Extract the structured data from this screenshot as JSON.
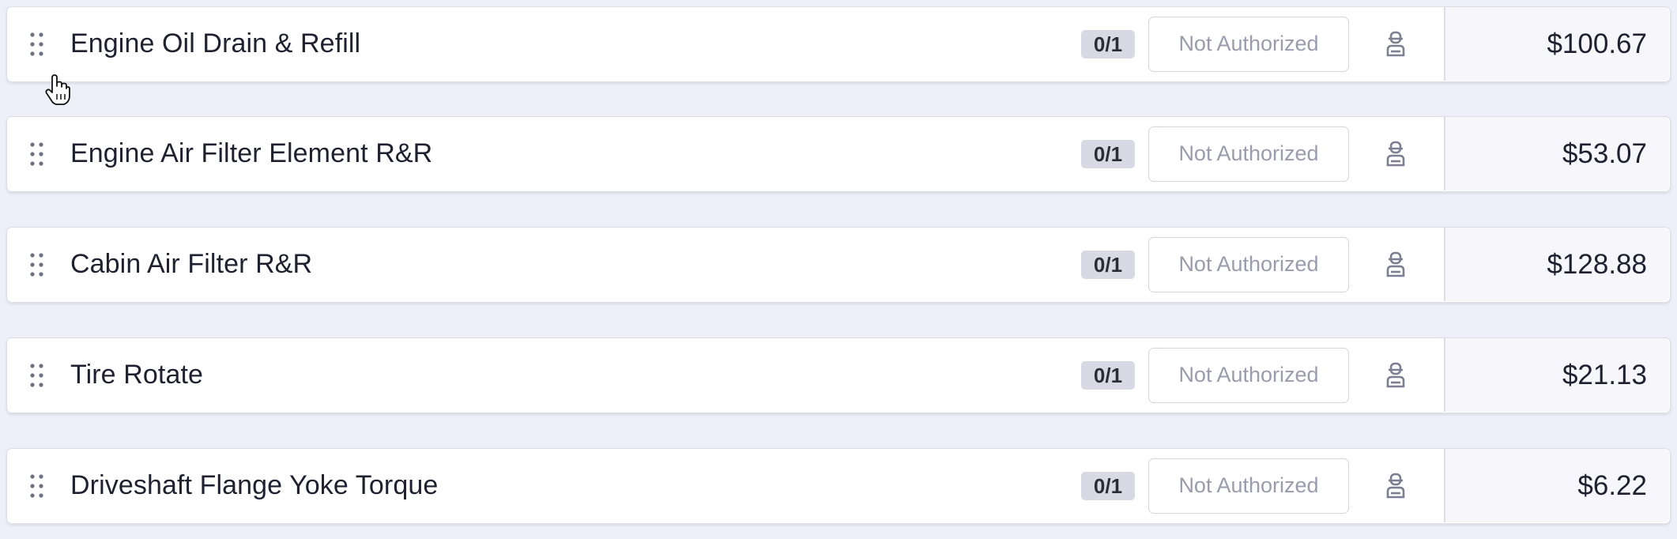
{
  "services": [
    {
      "name": "Engine Oil Drain & Refill",
      "quantity": "0/1",
      "status": "Not Authorized",
      "price": "$100.67"
    },
    {
      "name": "Engine Air Filter Element R&R",
      "quantity": "0/1",
      "status": "Not Authorized",
      "price": "$53.07"
    },
    {
      "name": "Cabin Air Filter R&R",
      "quantity": "0/1",
      "status": "Not Authorized",
      "price": "$128.88"
    },
    {
      "name": "Tire Rotate",
      "quantity": "0/1",
      "status": "Not Authorized",
      "price": "$21.13"
    },
    {
      "name": "Driveshaft Flange Yoke Torque",
      "quantity": "0/1",
      "status": "Not Authorized",
      "price": "$6.22"
    }
  ],
  "icons": {
    "drag": "drag-handle-icon",
    "technician": "technician-icon",
    "cursor": "hand-cursor-icon"
  },
  "colors": {
    "background": "#eeeff8",
    "card": "#ffffff",
    "badge": "#d8d9e4",
    "muted_text": "#9a9cad",
    "text": "#1f2130"
  }
}
